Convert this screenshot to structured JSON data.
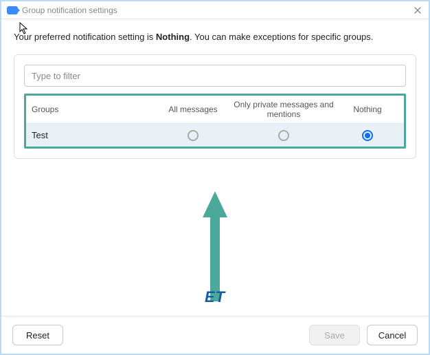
{
  "titlebar": {
    "title": "Group notification settings"
  },
  "pref": {
    "prefix": "Your preferred notification setting is ",
    "current": "Nothing",
    "suffix": ". You can make exceptions for specific groups."
  },
  "filter": {
    "placeholder": "Type to filter"
  },
  "columns": {
    "group": "Groups",
    "all": "All messages",
    "priv": "Only private messages and mentions",
    "nothing": "Nothing"
  },
  "rows": [
    {
      "name": "Test",
      "selected": "nothing"
    }
  ],
  "footer": {
    "reset": "Reset",
    "save": "Save",
    "cancel": "Cancel"
  },
  "watermark": "ET"
}
